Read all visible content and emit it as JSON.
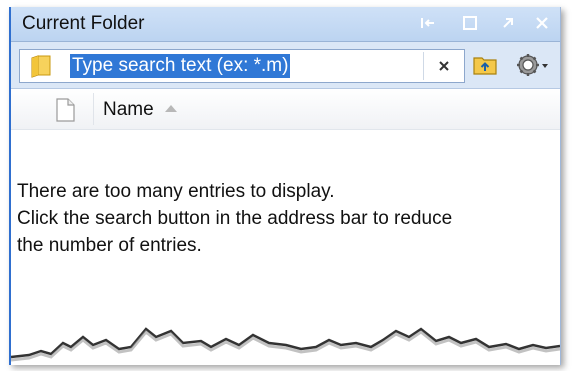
{
  "window": {
    "title": "Current Folder",
    "buttons": [
      "pin-icon",
      "maximize-icon",
      "undock-icon",
      "close-icon"
    ]
  },
  "address_bar": {
    "search_placeholder": "Type search text (ex: *.m)",
    "icons": [
      "folder-icon",
      "clear-icon",
      "up-folder-icon",
      "gear-icon"
    ]
  },
  "file_list": {
    "column_name": "Name",
    "sort": "ascending"
  },
  "message": {
    "line1": "There are too many entries to display.",
    "line2": "Click the search button in the address bar to reduce",
    "line3": "the number of entries."
  },
  "colors": {
    "title_bar": "#c9dcf4",
    "accent": "#2f6fcf",
    "selection": "#3078d6"
  }
}
